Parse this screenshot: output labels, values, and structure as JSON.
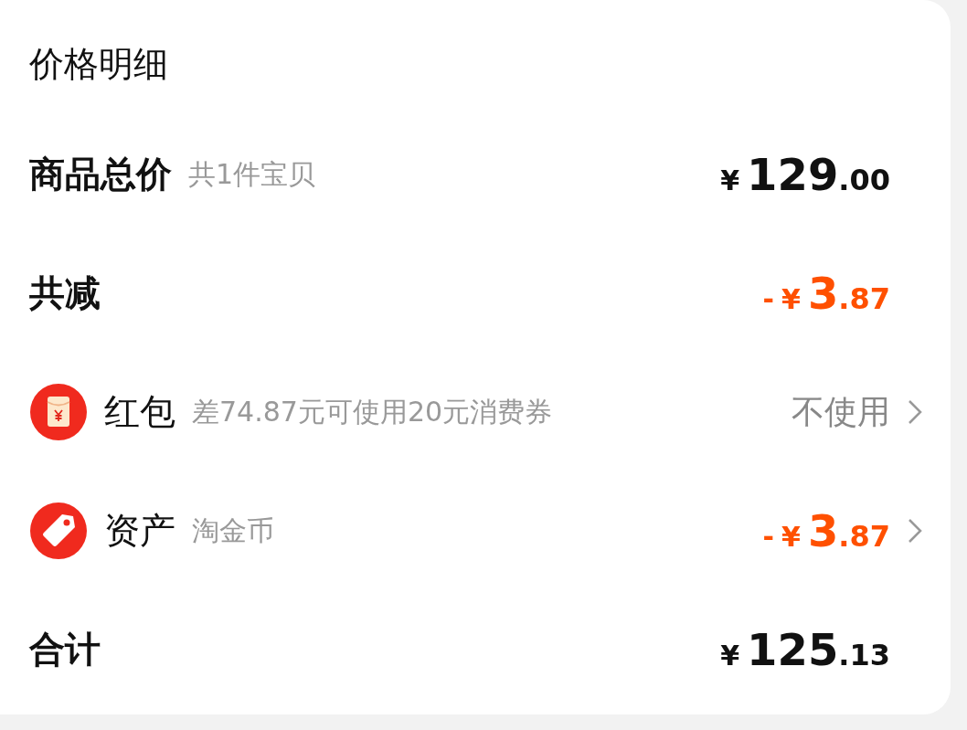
{
  "title": "价格明细",
  "rows": [
    {
      "kind": "plain",
      "label": "商品总价",
      "note": "共1件宝贝",
      "price": {
        "currency": "¥",
        "integer": "129",
        "decimal": ".00"
      },
      "chevron": false
    },
    {
      "kind": "plain",
      "label": "共减",
      "price": {
        "sign": "-",
        "currency": "¥",
        "integer": "3",
        "decimal": ".87"
      },
      "chevron": false
    },
    {
      "kind": "envelope",
      "label": "红包",
      "note": "差74.87元可使用20元消费券",
      "value": "不使用",
      "chevron": true
    },
    {
      "kind": "tag",
      "label": "资产",
      "note": "淘金币",
      "price": {
        "sign": "-",
        "currency": "¥",
        "integer": "3",
        "decimal": ".87"
      },
      "chevron": true
    },
    {
      "kind": "plain",
      "label": "合计",
      "price": {
        "currency": "¥",
        "integer": "125",
        "decimal": ".13"
      },
      "chevron": false
    }
  ]
}
